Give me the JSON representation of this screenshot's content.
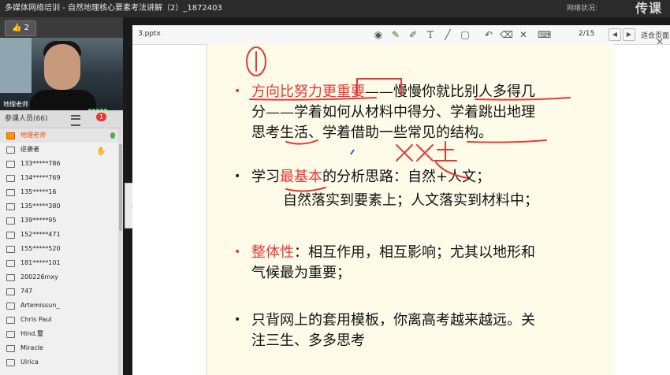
{
  "window": {
    "title": "多媒体网络培训 - 自然地理核心要素考法讲解（2）_1872403",
    "network": "网络状况:",
    "watermark": "传课"
  },
  "like": {
    "count": "2"
  },
  "video": {
    "label": "地理老师"
  },
  "members": {
    "header": "参课人员(66)",
    "badge": "1",
    "items": [
      "地理老师",
      "逆袭者",
      "133*****786",
      "134*****769",
      "135*****16",
      "135*****380",
      "139*****95",
      "152*****471",
      "155*****520",
      "181*****101",
      "200226mxy",
      "747",
      "Artemissun_",
      "Chris Paul",
      "Hind.璽",
      "Miracle",
      "Ulrica"
    ]
  },
  "toolbar": {
    "file": "3.pptx",
    "page": "2/15",
    "fit": "适合页面"
  },
  "colors": {
    "teacher": "#e65100",
    "red": "#e53935",
    "slide_bg": "#fffbe9"
  },
  "palette": [
    "#111111",
    "#d32f2f",
    "#2e7d32",
    "#e91e63",
    "#e040fb",
    "#00bcd4",
    "#ffeb3b",
    "#ff9800",
    "#8d6e63"
  ],
  "slide": {
    "b1_red": "方向比努力更重要",
    "b1_a": "——慢慢你就比别人多得几",
    "b1_b": "分——学着如何从材料中得分、学着跳出地理",
    "b1_c": "思考生活、学着借助一些常见的结构。",
    "b2_a": "学习",
    "b2_red": "最基本",
    "b2_b": "的分析思路：自然+人文；",
    "b2_c": "自然落实到要素上；人文落实到材料中；",
    "b3_red": "整体性",
    "b3_a": "：相互作用，相互影响；尤其以地形和",
    "b3_b": "气候最为重要；",
    "b4_a": "只背网上的套用模板，你离高考越来越远。关",
    "b4_b": "注三生、多多思考"
  }
}
